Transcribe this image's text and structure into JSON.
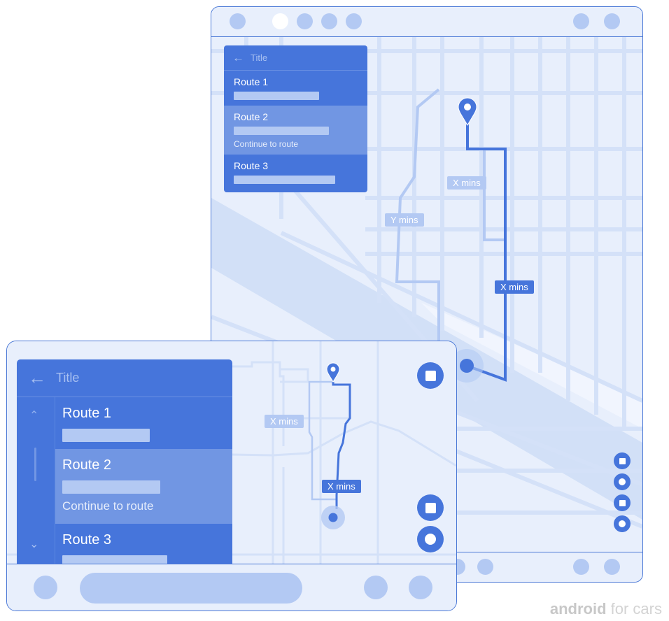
{
  "colors": {
    "accent": "#4675db",
    "accent_light": "#b3c9f3",
    "selected_row": "#7196e3",
    "map_bg": "#e8effc",
    "road": "#d4e1f8",
    "outline": "#4a78d6",
    "brand_text": "#d3d3d3"
  },
  "large_screen": {
    "top_bar": {
      "icons": [
        "status-dot",
        "status-dot-active",
        "status-dot",
        "status-dot",
        "status-dot",
        "status-dot",
        "status-dot"
      ]
    },
    "panel": {
      "back_icon": "←",
      "title": "Title",
      "routes": [
        {
          "label": "Route 1",
          "selected": false
        },
        {
          "label": "Route 2",
          "selected": true,
          "action": "Continue to route"
        },
        {
          "label": "Route 3",
          "selected": false
        }
      ]
    },
    "map_labels": [
      {
        "text": "X mins",
        "style": "light"
      },
      {
        "text": "Y mins",
        "style": "light"
      },
      {
        "text": "X mins",
        "style": "dark"
      }
    ],
    "map_controls": [
      "stop-icon",
      "record-icon",
      "stop-icon",
      "record-icon"
    ]
  },
  "small_screen": {
    "panel": {
      "back_icon": "←",
      "title": "Title",
      "scroll_up_icon": "⌃",
      "scroll_down_icon": "⌄",
      "routes": [
        {
          "label": "Route 1",
          "selected": false
        },
        {
          "label": "Route 2",
          "selected": true,
          "action": "Continue to route"
        },
        {
          "label": "Route 3",
          "selected": false
        }
      ]
    },
    "map_labels": [
      {
        "text": "X mins",
        "style": "light"
      },
      {
        "text": "X mins",
        "style": "dark"
      }
    ],
    "map_controls": [
      "stop-icon",
      "stop-icon",
      "record-icon"
    ]
  },
  "brand": {
    "bold": "android",
    "rest": " for cars"
  }
}
